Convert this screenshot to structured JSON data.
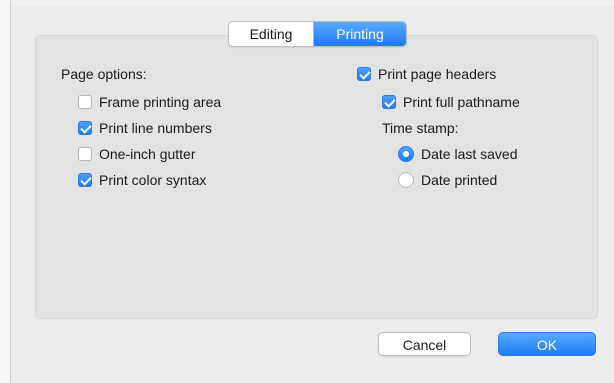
{
  "tabs": [
    {
      "label": "Editing",
      "selected": false
    },
    {
      "label": "Printing",
      "selected": true
    }
  ],
  "page_options": {
    "heading": "Page options:",
    "items": [
      {
        "label": "Frame printing area",
        "checked": false
      },
      {
        "label": "Print line numbers",
        "checked": true
      },
      {
        "label": "One-inch gutter",
        "checked": false
      },
      {
        "label": "Print color syntax",
        "checked": true
      }
    ]
  },
  "headers": {
    "print_page_headers": {
      "label": "Print page headers",
      "checked": true
    },
    "print_full_pathname": {
      "label": "Print full pathname",
      "checked": true
    },
    "time_stamp_label": "Time stamp:",
    "time_stamp_options": [
      {
        "label": "Date last saved",
        "selected": true
      },
      {
        "label": "Date printed",
        "selected": false
      }
    ]
  },
  "buttons": {
    "cancel": "Cancel",
    "ok": "OK"
  },
  "colors": {
    "accent": "#1e7cf6",
    "panel": "#e3e3e3",
    "window": "#ececec"
  }
}
